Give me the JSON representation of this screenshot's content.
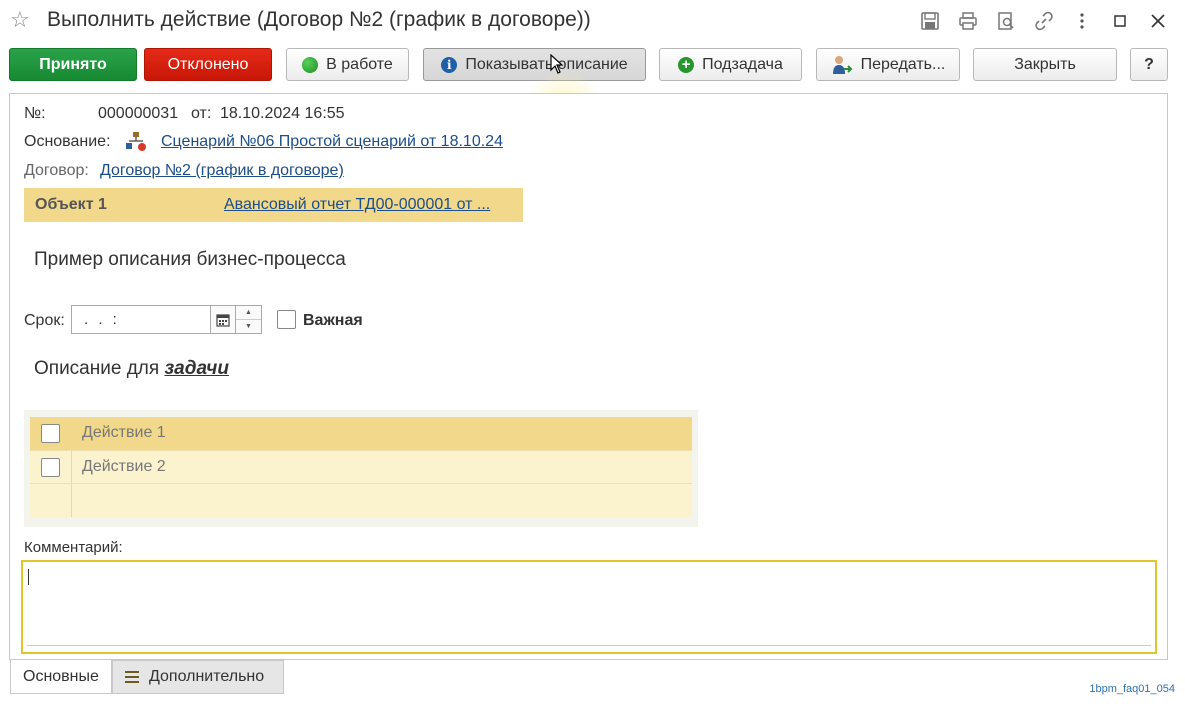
{
  "window": {
    "title": "Выполнить действие (Договор №2 (график в договоре))"
  },
  "toolbar": {
    "accepted": "Принято",
    "rejected": "Отклонено",
    "in_progress": "В работе",
    "show_description": "Показывать описание",
    "subtask": "Подзадача",
    "transfer": "Передать...",
    "close": "Закрыть",
    "help": "?"
  },
  "form": {
    "number_label": "№:",
    "number_value": "000000031",
    "from_label": "от:",
    "date_value": "18.10.2024 16:55",
    "basis_label": "Основание:",
    "basis_link": "Сценарий №06 Простой сценарий от 18.10.24",
    "contract_label": "Договор:",
    "contract_link": "Договор №2 (график в договоре)",
    "object_label": "Объект 1",
    "object_link": "Авансовый отчет ТД00-000001 от ...",
    "process_description": "Пример описания бизнес-процесса",
    "deadline_label": "Срок:",
    "deadline_value": ". .   :",
    "important_label": "Важная",
    "task_description_prefix": "Описание для",
    "task_description_emphasis": "задачи",
    "actions": [
      {
        "label": "Действие 1",
        "checked": false
      },
      {
        "label": "Действие 2",
        "checked": false
      }
    ],
    "comment_label": "Комментарий:",
    "comment_value": ""
  },
  "tabs": {
    "main": "Основные",
    "additional": "Дополнительно"
  },
  "watermark": "1bpm_faq01_054",
  "colors": {
    "accept": "#178a32",
    "reject": "#c81707",
    "highlight_row": "#f2d88a",
    "link": "#1d4e86",
    "comment_border": "#e0c52e"
  }
}
